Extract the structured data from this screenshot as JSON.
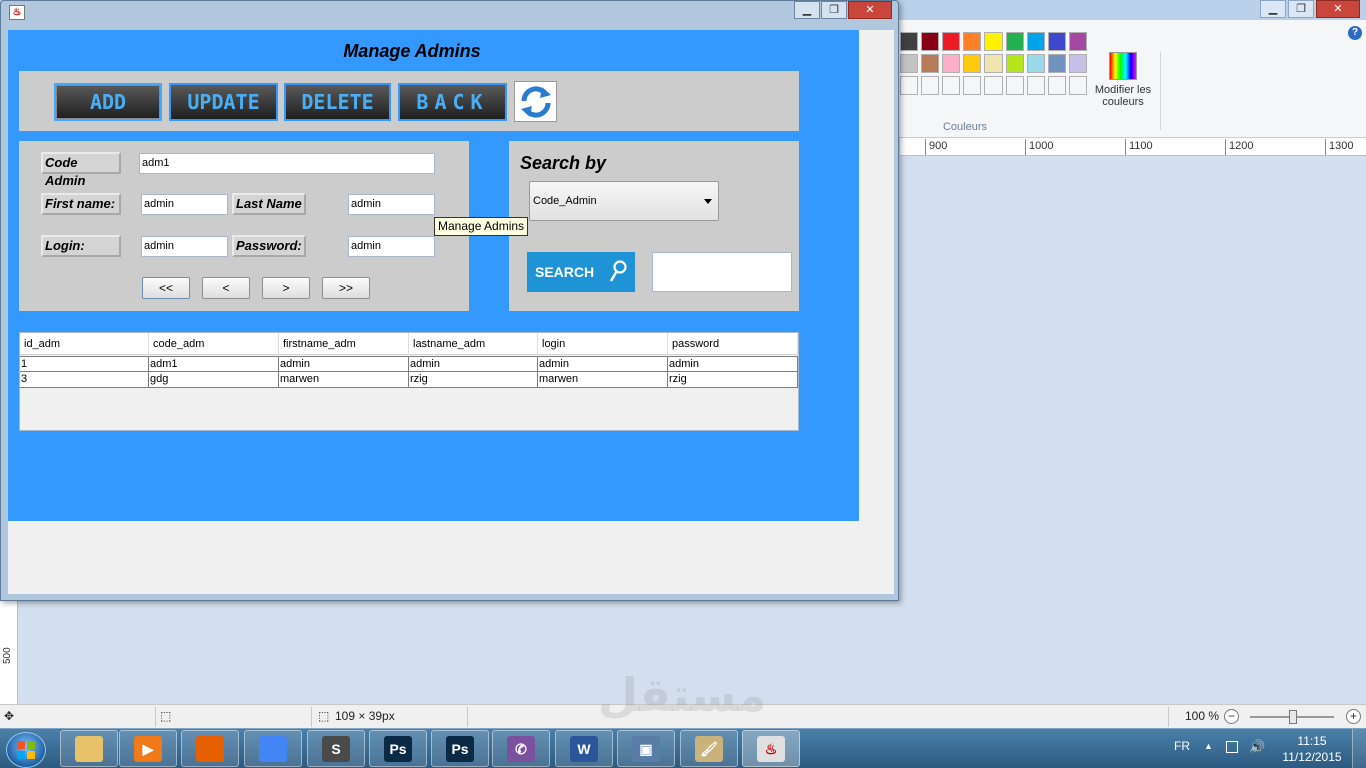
{
  "paint": {
    "palette_label": "Couleurs",
    "edit_colors_label": "Modifier les couleurs",
    "help": "?",
    "palette_rows": [
      [
        "#404040",
        "#880015",
        "#ed1c24",
        "#ff7f27",
        "#fff200",
        "#22b14c",
        "#00a2e8",
        "#3f48cc",
        "#a349a4"
      ],
      [
        "#c3c3c3",
        "#b97a57",
        "#ffaec9",
        "#ffc90e",
        "#efe4b0",
        "#b5e61d",
        "#99d9ea",
        "#7092be",
        "#c8bfe7"
      ],
      [
        "#f5f6f7",
        "#f5f6f7",
        "#f5f6f7",
        "#f5f6f7",
        "#f5f6f7",
        "#f5f6f7",
        "#f5f6f7",
        "#f5f6f7",
        "#f5f6f7"
      ]
    ],
    "ruler_ticks": [
      "900",
      "1000",
      "1100",
      "1200",
      "1300"
    ],
    "ruler_v_label": "500",
    "status": {
      "selection_size": "109 × 39px",
      "zoom": "100 %"
    }
  },
  "java_window": {
    "title": "Manage Admins",
    "buttons": {
      "add": "ADD",
      "update": "UPDATE",
      "delete": "DELETE",
      "back": "BACK"
    },
    "fields": {
      "code_admin": {
        "label": "Code Admin",
        "value": "adm1"
      },
      "first_name": {
        "label": "First name:",
        "value": "admin"
      },
      "last_name": {
        "label": "Last Name",
        "value": "admin"
      },
      "login": {
        "label": "Login:",
        "value": "admin"
      },
      "password": {
        "label": "Password:",
        "value": "admin"
      }
    },
    "nav": {
      "first": "<<",
      "prev": "<",
      "next": ">",
      "last": ">>"
    },
    "search": {
      "title": "Search by",
      "selected": "Code_Admin",
      "button": "SEARCH",
      "query": ""
    },
    "table": {
      "columns": [
        "id_adm",
        "code_adm",
        "firstname_adm",
        "lastname_adm",
        "login",
        "password"
      ],
      "rows": [
        [
          "1",
          "adm1",
          "admin",
          "admin",
          "admin",
          "admin"
        ],
        [
          "3",
          "gdg",
          "marwen",
          "rzig",
          "marwen",
          "rzig"
        ]
      ]
    },
    "tooltip": "Manage Admins"
  },
  "taskbar": {
    "lang": "FR",
    "time": "11:15",
    "date": "11/12/2015",
    "items": [
      {
        "name": "explorer",
        "glyph": "",
        "color": "#e8c26a"
      },
      {
        "name": "media-player",
        "glyph": "▶",
        "color": "#f07a1a"
      },
      {
        "name": "firefox",
        "glyph": "",
        "color": "#e66000"
      },
      {
        "name": "chrome",
        "glyph": "",
        "color": "#4285f4"
      },
      {
        "name": "sublime-text",
        "glyph": "S",
        "color": "#4a4a4a"
      },
      {
        "name": "photoshop",
        "glyph": "Ps",
        "color": "#0a2a46"
      },
      {
        "name": "photoshop-2",
        "glyph": "Ps",
        "color": "#0a2a46"
      },
      {
        "name": "viber",
        "glyph": "✆",
        "color": "#7b519d"
      },
      {
        "name": "word",
        "glyph": "W",
        "color": "#2b579a"
      },
      {
        "name": "virtualbox",
        "glyph": "▣",
        "color": "#5a7da8"
      },
      {
        "name": "paint",
        "glyph": "🖌",
        "color": "#c9b37a"
      },
      {
        "name": "java",
        "glyph": "♨",
        "color": "#e0e0e0"
      }
    ]
  },
  "watermark": "مستقل"
}
